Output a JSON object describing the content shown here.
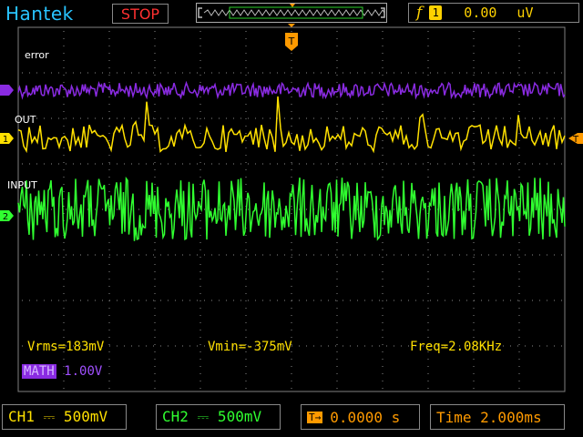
{
  "header": {
    "brand": "Hantek",
    "run_state": "STOP",
    "trigger_slope": "f",
    "trigger_channel": "1",
    "trigger_level": "0.00",
    "trigger_unit": "uV"
  },
  "trace_labels": {
    "ch3": "error",
    "ch1": "OUT",
    "ch2": "INPUT"
  },
  "channel_markers": {
    "ch1": "1",
    "ch2": "2"
  },
  "measurements": {
    "vrms": "Vrms=183mV",
    "vmin": "Vmin=-375mV",
    "freq": "Freq=2.08KHz"
  },
  "math": {
    "tag": "MATH",
    "value": "1.00V"
  },
  "bottom": {
    "ch1": "CH1 ⎓ 500mV",
    "ch2": "CH2 ⎓ 500mV",
    "trig_offset_badge": "T→",
    "trig_offset": "0.0000 s",
    "timebase": "Time 2.000ms"
  },
  "colors": {
    "ch1": "#ffe000",
    "ch2": "#30ff30",
    "math": "#8a2be2",
    "trigger": "#ff9a00",
    "brand": "#29c4ff",
    "stop": "#ff3030"
  }
}
